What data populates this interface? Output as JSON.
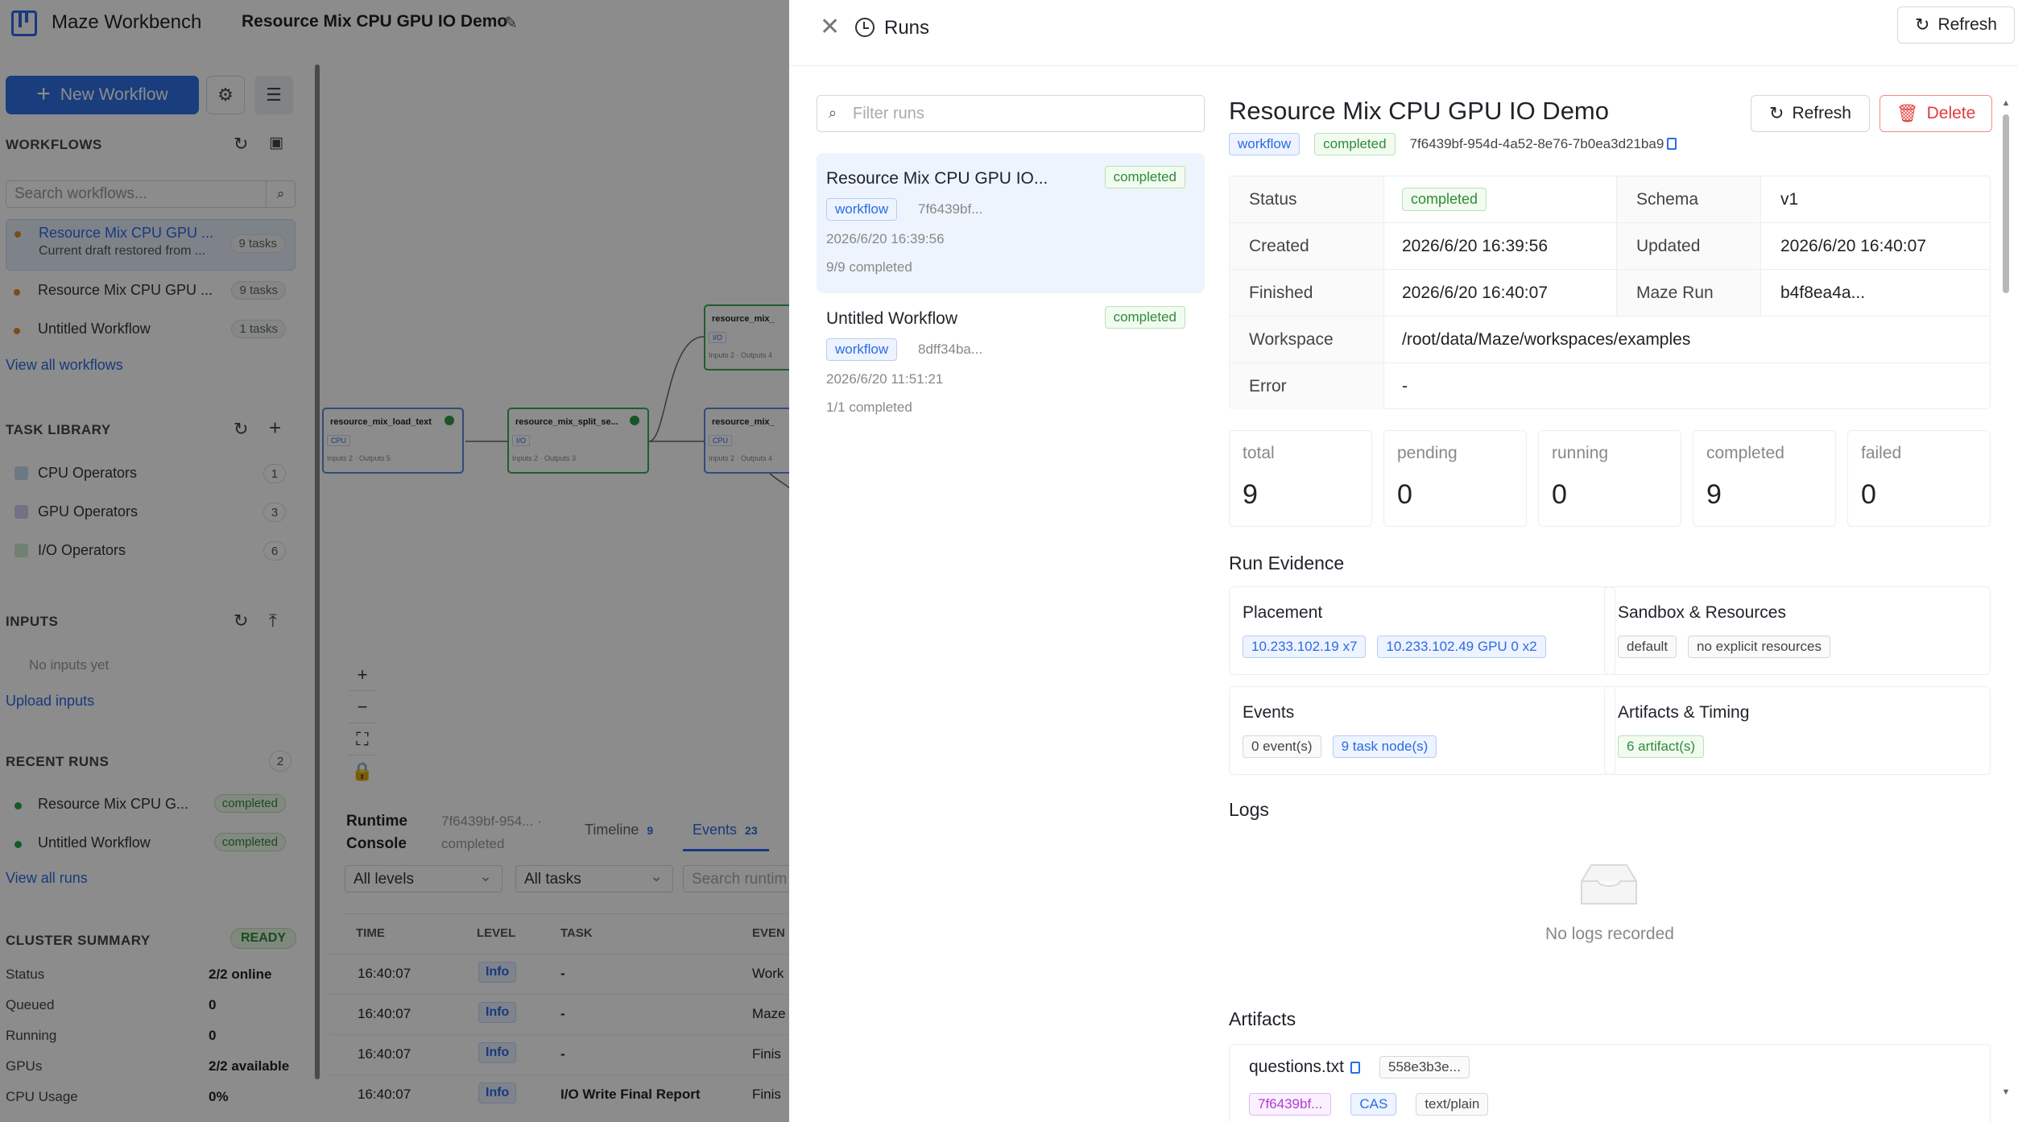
{
  "app": {
    "name": "Maze Workbench",
    "workflow_title": "Resource Mix CPU GPU IO Demo"
  },
  "sidebar": {
    "new_workflow_label": "New Workflow",
    "workflows_heading": "WORKFLOWS",
    "search_placeholder": "Search workflows...",
    "workflows": [
      {
        "name": "Resource Mix CPU GPU ...",
        "sub": "Current draft restored from ...",
        "badge": "9 tasks"
      },
      {
        "name": "Resource Mix CPU GPU ...",
        "badge": "9 tasks"
      },
      {
        "name": "Untitled Workflow",
        "badge": "1 tasks"
      }
    ],
    "view_all_workflows": "View all workflows",
    "task_library_heading": "TASK LIBRARY",
    "task_library": [
      {
        "name": "CPU Operators",
        "count": "1",
        "color": "#c7daf2"
      },
      {
        "name": "GPU Operators",
        "count": "3",
        "color": "#d9cdee"
      },
      {
        "name": "I/O Operators",
        "count": "6",
        "color": "#cfe8d2"
      }
    ],
    "inputs_heading": "INPUTS",
    "no_inputs": "No inputs yet",
    "upload_inputs": "Upload inputs",
    "recent_runs_heading": "RECENT RUNS",
    "recent_runs_count": "2",
    "recent_runs": [
      {
        "name": "Resource Mix CPU G...",
        "status": "completed"
      },
      {
        "name": "Untitled Workflow",
        "status": "completed"
      }
    ],
    "view_all_runs": "View all runs",
    "cluster_heading": "CLUSTER SUMMARY",
    "cluster_status": "READY",
    "cluster_rows": [
      {
        "label": "Status",
        "value": "2/2 online"
      },
      {
        "label": "Queued",
        "value": "0"
      },
      {
        "label": "Running",
        "value": "0"
      },
      {
        "label": "GPUs",
        "value": "2/2 available"
      },
      {
        "label": "CPU Usage",
        "value": "0%"
      }
    ]
  },
  "canvas": {
    "nodes": [
      {
        "title": "resource_mix_load_text",
        "tag": "CPU",
        "foot": "Inputs 2 · Outputs 5"
      },
      {
        "title": "resource_mix_split_se...",
        "tag": "I/O",
        "foot": "Inputs 2 · Outputs 3"
      },
      {
        "title": "resource_mix_",
        "tag": "I/O",
        "foot": "Inputs 2 · Outputs 4"
      },
      {
        "title": "resource_mix_",
        "tag": "CPU",
        "foot": "Inputs 2 · Outputs 4"
      }
    ]
  },
  "console": {
    "title": "Runtime Console",
    "run_id": "7f6439bf-954... ·",
    "run_status": "completed",
    "tabs": [
      {
        "label": "Timeline",
        "count": "9"
      },
      {
        "label": "Events",
        "count": "23"
      }
    ],
    "level_filter": "All levels",
    "task_filter": "All tasks",
    "search_placeholder": "Search runtim",
    "columns": [
      "TIME",
      "LEVEL",
      "TASK",
      "EVEN"
    ],
    "rows": [
      {
        "time": "16:40:07",
        "level": "Info",
        "task": "-",
        "event": "Work"
      },
      {
        "time": "16:40:07",
        "level": "Info",
        "task": "-",
        "event": "Maze"
      },
      {
        "time": "16:40:07",
        "level": "Info",
        "task": "-",
        "event": "Finis"
      },
      {
        "time": "16:40:07",
        "level": "Info",
        "task": "I/O Write Final Report",
        "event": "Finis"
      }
    ]
  },
  "drawer": {
    "title": "Runs",
    "refresh_label": "Refresh",
    "filter_placeholder": "Filter runs",
    "runs": [
      {
        "title": "Resource Mix CPU GPU IO...",
        "status": "completed",
        "tag": "workflow",
        "hash": "7f6439bf...",
        "date": "2026/6/20 16:39:56",
        "progress": "9/9 completed"
      },
      {
        "title": "Untitled Workflow",
        "status": "completed",
        "tag": "workflow",
        "hash": "8dff34ba...",
        "date": "2026/6/20 11:51:21",
        "progress": "1/1 completed"
      }
    ],
    "detail": {
      "title": "Resource Mix CPU GPU IO Demo",
      "tag": "workflow",
      "status": "completed",
      "run_id": "7f6439bf-954d-4a52-8e76-7b0ea3d21ba9",
      "refresh_label": "Refresh",
      "delete_label": "Delete",
      "info": {
        "status_label": "Status",
        "status_value": "completed",
        "schema_label": "Schema",
        "schema_value": "v1",
        "created_label": "Created",
        "created_value": "2026/6/20 16:39:56",
        "updated_label": "Updated",
        "updated_value": "2026/6/20 16:40:07",
        "finished_label": "Finished",
        "finished_value": "2026/6/20 16:40:07",
        "mazerun_label": "Maze Run",
        "mazerun_value": "b4f8ea4a...",
        "workspace_label": "Workspace",
        "workspace_value": "/root/data/Maze/workspaces/examples",
        "error_label": "Error",
        "error_value": "-"
      },
      "stats": [
        {
          "label": "total",
          "value": "9"
        },
        {
          "label": "pending",
          "value": "0"
        },
        {
          "label": "running",
          "value": "0"
        },
        {
          "label": "completed",
          "value": "9"
        },
        {
          "label": "failed",
          "value": "0"
        }
      ],
      "evidence_heading": "Run Evidence",
      "placement": {
        "title": "Placement",
        "tags": [
          "10.233.102.19 x7",
          "10.233.102.49 GPU 0 x2"
        ]
      },
      "sandbox": {
        "title": "Sandbox & Resources",
        "tags": [
          "default",
          "no explicit resources"
        ]
      },
      "events": {
        "title": "Events",
        "tag_gray": "0 event(s)",
        "tag_blue": "9 task node(s)"
      },
      "timing": {
        "title": "Artifacts & Timing",
        "tag": "6 artifact(s)"
      },
      "logs_heading": "Logs",
      "no_logs": "No logs recorded",
      "artifacts_heading": "Artifacts",
      "artifact": {
        "name": "questions.txt",
        "hash": "558e3b3e...",
        "tags": [
          "7f6439bf...",
          "CAS",
          "text/plain"
        ]
      }
    }
  }
}
